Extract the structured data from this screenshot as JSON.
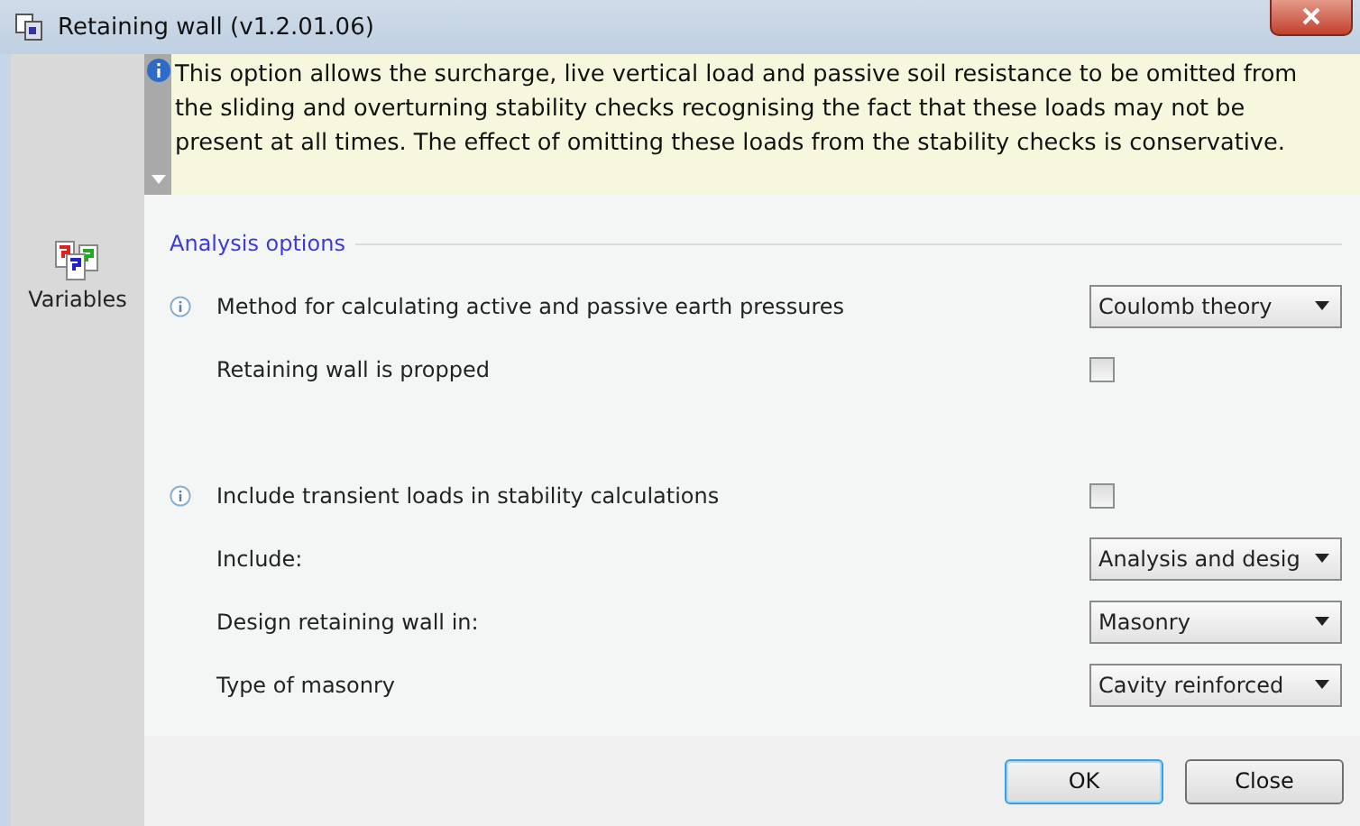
{
  "window": {
    "title": "Retaining wall (v1.2.01.06)"
  },
  "sidebar": {
    "items": [
      {
        "label": "Variables",
        "selected": false
      }
    ]
  },
  "help": {
    "text": "This option allows the surcharge, live vertical load and passive soil resistance to be omitted from the sliding and overturning stability checks recognising the fact that these loads may not be present at all times. The effect of omitting these loads from the stability checks is conservative."
  },
  "group": {
    "title": "Analysis options"
  },
  "rows": [
    {
      "kind": "dropdown",
      "label": "Method for calculating active and passive earth pressures",
      "info": true,
      "value": "Coulomb theory"
    },
    {
      "kind": "checkbox",
      "label": "Retaining wall is propped",
      "info": false,
      "checked": false
    },
    {
      "kind": "spacer"
    },
    {
      "kind": "checkbox",
      "label": "Include transient loads in stability calculations",
      "info": true,
      "checked": false
    },
    {
      "kind": "dropdown",
      "label": "Include:",
      "info": false,
      "value": "Analysis and desig"
    },
    {
      "kind": "dropdown",
      "label": "Design retaining wall in:",
      "info": false,
      "value": "Masonry"
    },
    {
      "kind": "dropdown",
      "label": "Type of masonry",
      "info": false,
      "value": "Cavity reinforced"
    }
  ],
  "buttons": [
    {
      "label": "OK",
      "default": true
    },
    {
      "label": "Close",
      "default": false
    }
  ]
}
